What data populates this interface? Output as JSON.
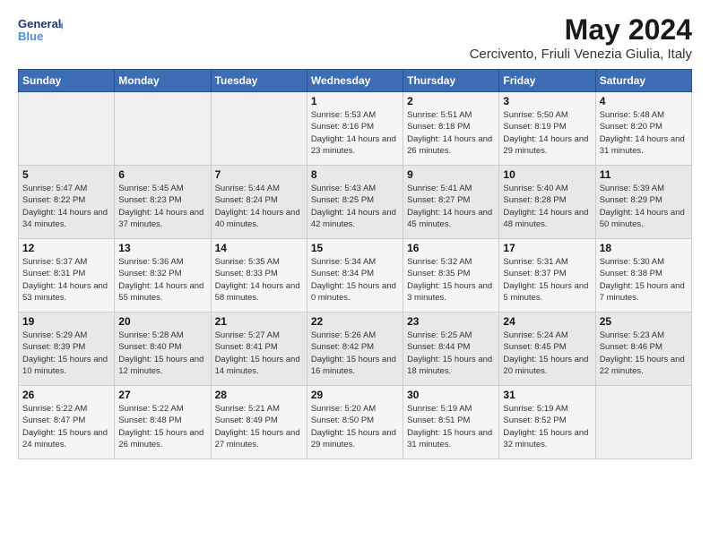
{
  "logo": {
    "line1": "General",
    "line2": "Blue"
  },
  "title": "May 2024",
  "subtitle": "Cercivento, Friuli Venezia Giulia, Italy",
  "weekdays": [
    "Sunday",
    "Monday",
    "Tuesday",
    "Wednesday",
    "Thursday",
    "Friday",
    "Saturday"
  ],
  "weeks": [
    [
      null,
      null,
      null,
      {
        "day": 1,
        "sunrise": "5:53 AM",
        "sunset": "8:16 PM",
        "daylight": "14 hours and 23 minutes."
      },
      {
        "day": 2,
        "sunrise": "5:51 AM",
        "sunset": "8:18 PM",
        "daylight": "14 hours and 26 minutes."
      },
      {
        "day": 3,
        "sunrise": "5:50 AM",
        "sunset": "8:19 PM",
        "daylight": "14 hours and 29 minutes."
      },
      {
        "day": 4,
        "sunrise": "5:48 AM",
        "sunset": "8:20 PM",
        "daylight": "14 hours and 31 minutes."
      }
    ],
    [
      {
        "day": 5,
        "sunrise": "5:47 AM",
        "sunset": "8:22 PM",
        "daylight": "14 hours and 34 minutes."
      },
      {
        "day": 6,
        "sunrise": "5:45 AM",
        "sunset": "8:23 PM",
        "daylight": "14 hours and 37 minutes."
      },
      {
        "day": 7,
        "sunrise": "5:44 AM",
        "sunset": "8:24 PM",
        "daylight": "14 hours and 40 minutes."
      },
      {
        "day": 8,
        "sunrise": "5:43 AM",
        "sunset": "8:25 PM",
        "daylight": "14 hours and 42 minutes."
      },
      {
        "day": 9,
        "sunrise": "5:41 AM",
        "sunset": "8:27 PM",
        "daylight": "14 hours and 45 minutes."
      },
      {
        "day": 10,
        "sunrise": "5:40 AM",
        "sunset": "8:28 PM",
        "daylight": "14 hours and 48 minutes."
      },
      {
        "day": 11,
        "sunrise": "5:39 AM",
        "sunset": "8:29 PM",
        "daylight": "14 hours and 50 minutes."
      }
    ],
    [
      {
        "day": 12,
        "sunrise": "5:37 AM",
        "sunset": "8:31 PM",
        "daylight": "14 hours and 53 minutes."
      },
      {
        "day": 13,
        "sunrise": "5:36 AM",
        "sunset": "8:32 PM",
        "daylight": "14 hours and 55 minutes."
      },
      {
        "day": 14,
        "sunrise": "5:35 AM",
        "sunset": "8:33 PM",
        "daylight": "14 hours and 58 minutes."
      },
      {
        "day": 15,
        "sunrise": "5:34 AM",
        "sunset": "8:34 PM",
        "daylight": "15 hours and 0 minutes."
      },
      {
        "day": 16,
        "sunrise": "5:32 AM",
        "sunset": "8:35 PM",
        "daylight": "15 hours and 3 minutes."
      },
      {
        "day": 17,
        "sunrise": "5:31 AM",
        "sunset": "8:37 PM",
        "daylight": "15 hours and 5 minutes."
      },
      {
        "day": 18,
        "sunrise": "5:30 AM",
        "sunset": "8:38 PM",
        "daylight": "15 hours and 7 minutes."
      }
    ],
    [
      {
        "day": 19,
        "sunrise": "5:29 AM",
        "sunset": "8:39 PM",
        "daylight": "15 hours and 10 minutes."
      },
      {
        "day": 20,
        "sunrise": "5:28 AM",
        "sunset": "8:40 PM",
        "daylight": "15 hours and 12 minutes."
      },
      {
        "day": 21,
        "sunrise": "5:27 AM",
        "sunset": "8:41 PM",
        "daylight": "15 hours and 14 minutes."
      },
      {
        "day": 22,
        "sunrise": "5:26 AM",
        "sunset": "8:42 PM",
        "daylight": "15 hours and 16 minutes."
      },
      {
        "day": 23,
        "sunrise": "5:25 AM",
        "sunset": "8:44 PM",
        "daylight": "15 hours and 18 minutes."
      },
      {
        "day": 24,
        "sunrise": "5:24 AM",
        "sunset": "8:45 PM",
        "daylight": "15 hours and 20 minutes."
      },
      {
        "day": 25,
        "sunrise": "5:23 AM",
        "sunset": "8:46 PM",
        "daylight": "15 hours and 22 minutes."
      }
    ],
    [
      {
        "day": 26,
        "sunrise": "5:22 AM",
        "sunset": "8:47 PM",
        "daylight": "15 hours and 24 minutes."
      },
      {
        "day": 27,
        "sunrise": "5:22 AM",
        "sunset": "8:48 PM",
        "daylight": "15 hours and 26 minutes."
      },
      {
        "day": 28,
        "sunrise": "5:21 AM",
        "sunset": "8:49 PM",
        "daylight": "15 hours and 27 minutes."
      },
      {
        "day": 29,
        "sunrise": "5:20 AM",
        "sunset": "8:50 PM",
        "daylight": "15 hours and 29 minutes."
      },
      {
        "day": 30,
        "sunrise": "5:19 AM",
        "sunset": "8:51 PM",
        "daylight": "15 hours and 31 minutes."
      },
      {
        "day": 31,
        "sunrise": "5:19 AM",
        "sunset": "8:52 PM",
        "daylight": "15 hours and 32 minutes."
      },
      null
    ]
  ]
}
